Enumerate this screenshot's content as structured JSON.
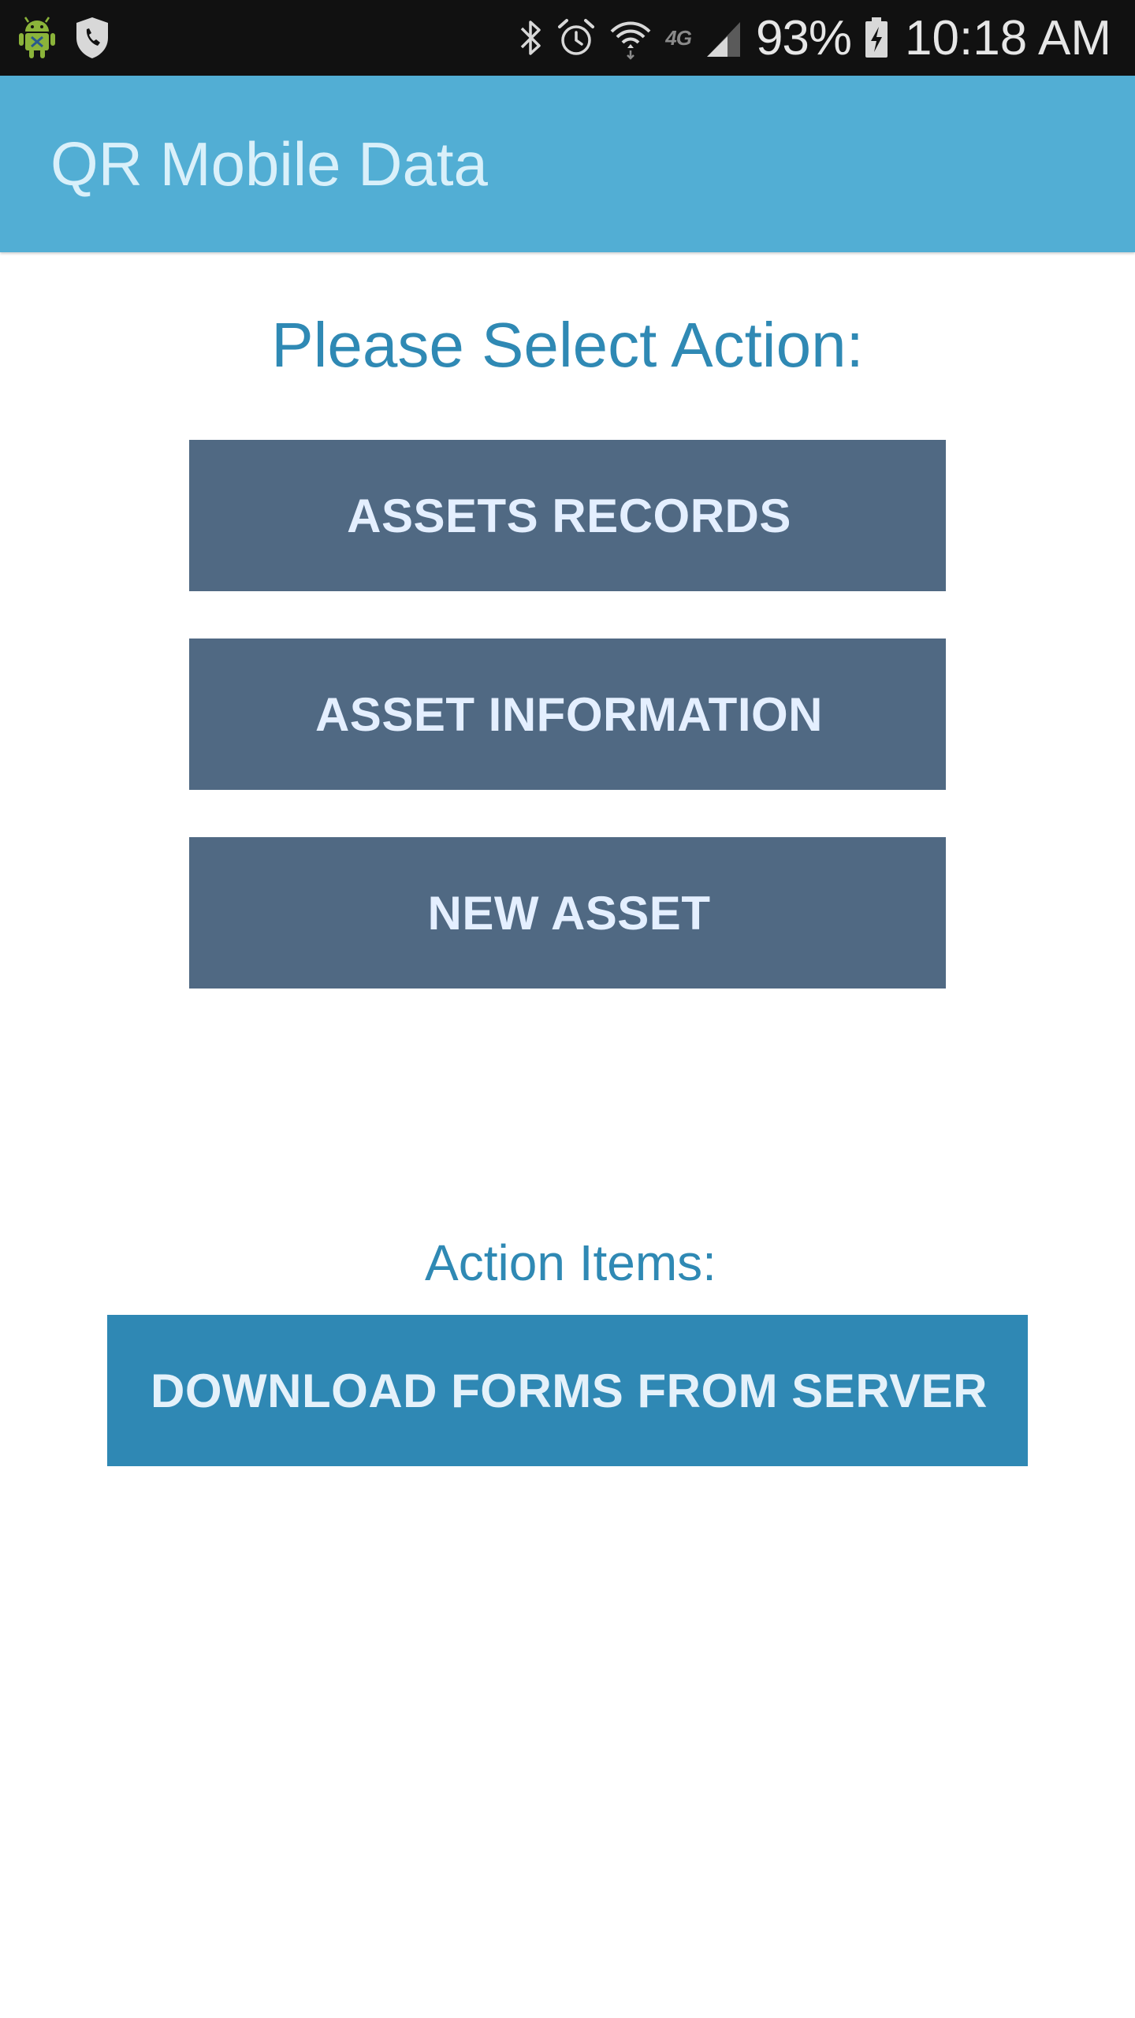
{
  "status_bar": {
    "left_icons": [
      "android-debug-icon",
      "shield-phone-icon"
    ],
    "right_icons": [
      "bluetooth-icon",
      "alarm-icon",
      "wifi-icon",
      "network-type-icon",
      "signal-icon",
      "battery-charging-icon"
    ],
    "network_type": "4G",
    "battery_percent": "93%",
    "time": "10:18 AM"
  },
  "app_bar": {
    "title": "QR Mobile Data",
    "color": "#52aed4"
  },
  "main": {
    "heading": "Please Select Action:",
    "buttons": [
      {
        "label": "ASSETS RECORDS"
      },
      {
        "label": "ASSET INFORMATION"
      },
      {
        "label": "NEW ASSET"
      }
    ],
    "button_color": "#506983"
  },
  "action_items": {
    "heading": "Action Items:",
    "download_button": {
      "label": "DOWNLOAD FORMS FROM SERVER"
    },
    "button_color": "#2f88b4"
  },
  "colors": {
    "accent_text": "#2f89b4",
    "status_bar": "#111111"
  }
}
